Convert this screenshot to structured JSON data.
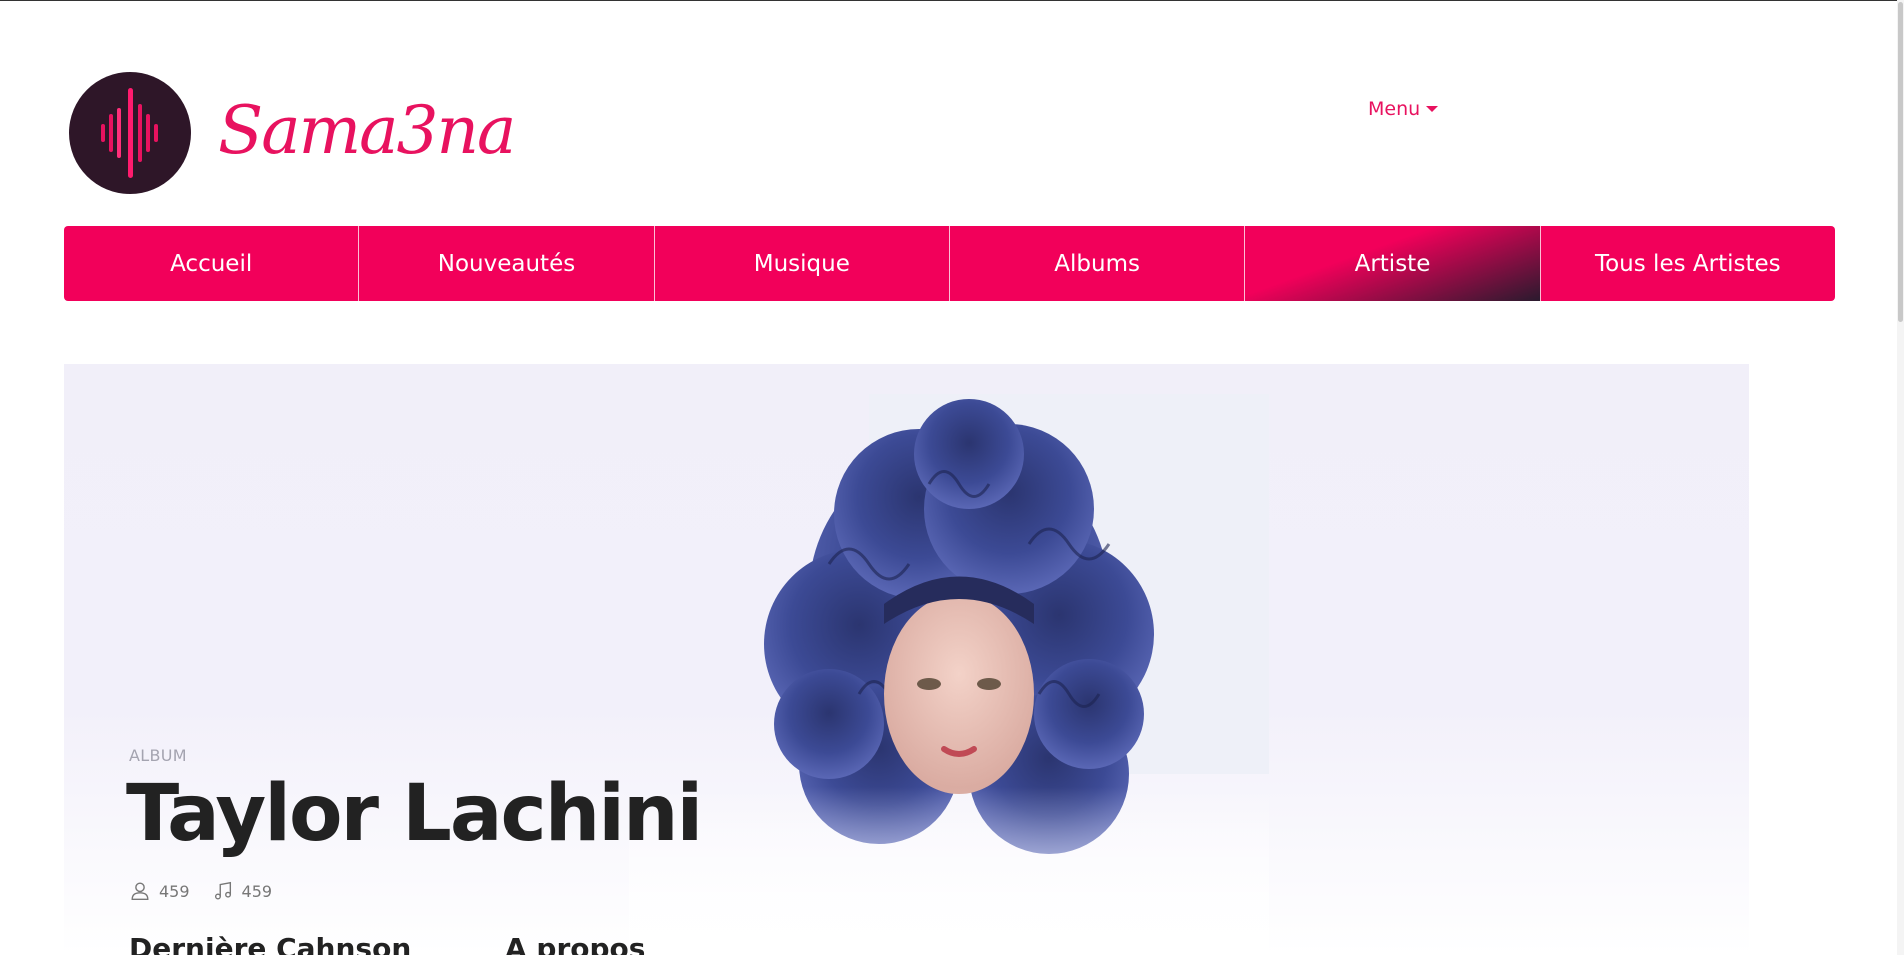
{
  "brand": {
    "name": "Sama3na",
    "accent": "#f2005a",
    "dark": "#2e1628"
  },
  "header": {
    "menu_label": "Menu"
  },
  "nav": {
    "items": [
      {
        "label": "Accueil"
      },
      {
        "label": "Nouveautés"
      },
      {
        "label": "Musique"
      },
      {
        "label": "Albums"
      },
      {
        "label": "Artiste",
        "active": true
      },
      {
        "label": "Tous les Artistes"
      }
    ]
  },
  "hero": {
    "label": "ALBUM",
    "artist_name": "Taylor Lachini",
    "followers": "459",
    "tracks": "459"
  },
  "sections": {
    "latest_song": "Dernière Cahnson",
    "about": "A propos"
  }
}
